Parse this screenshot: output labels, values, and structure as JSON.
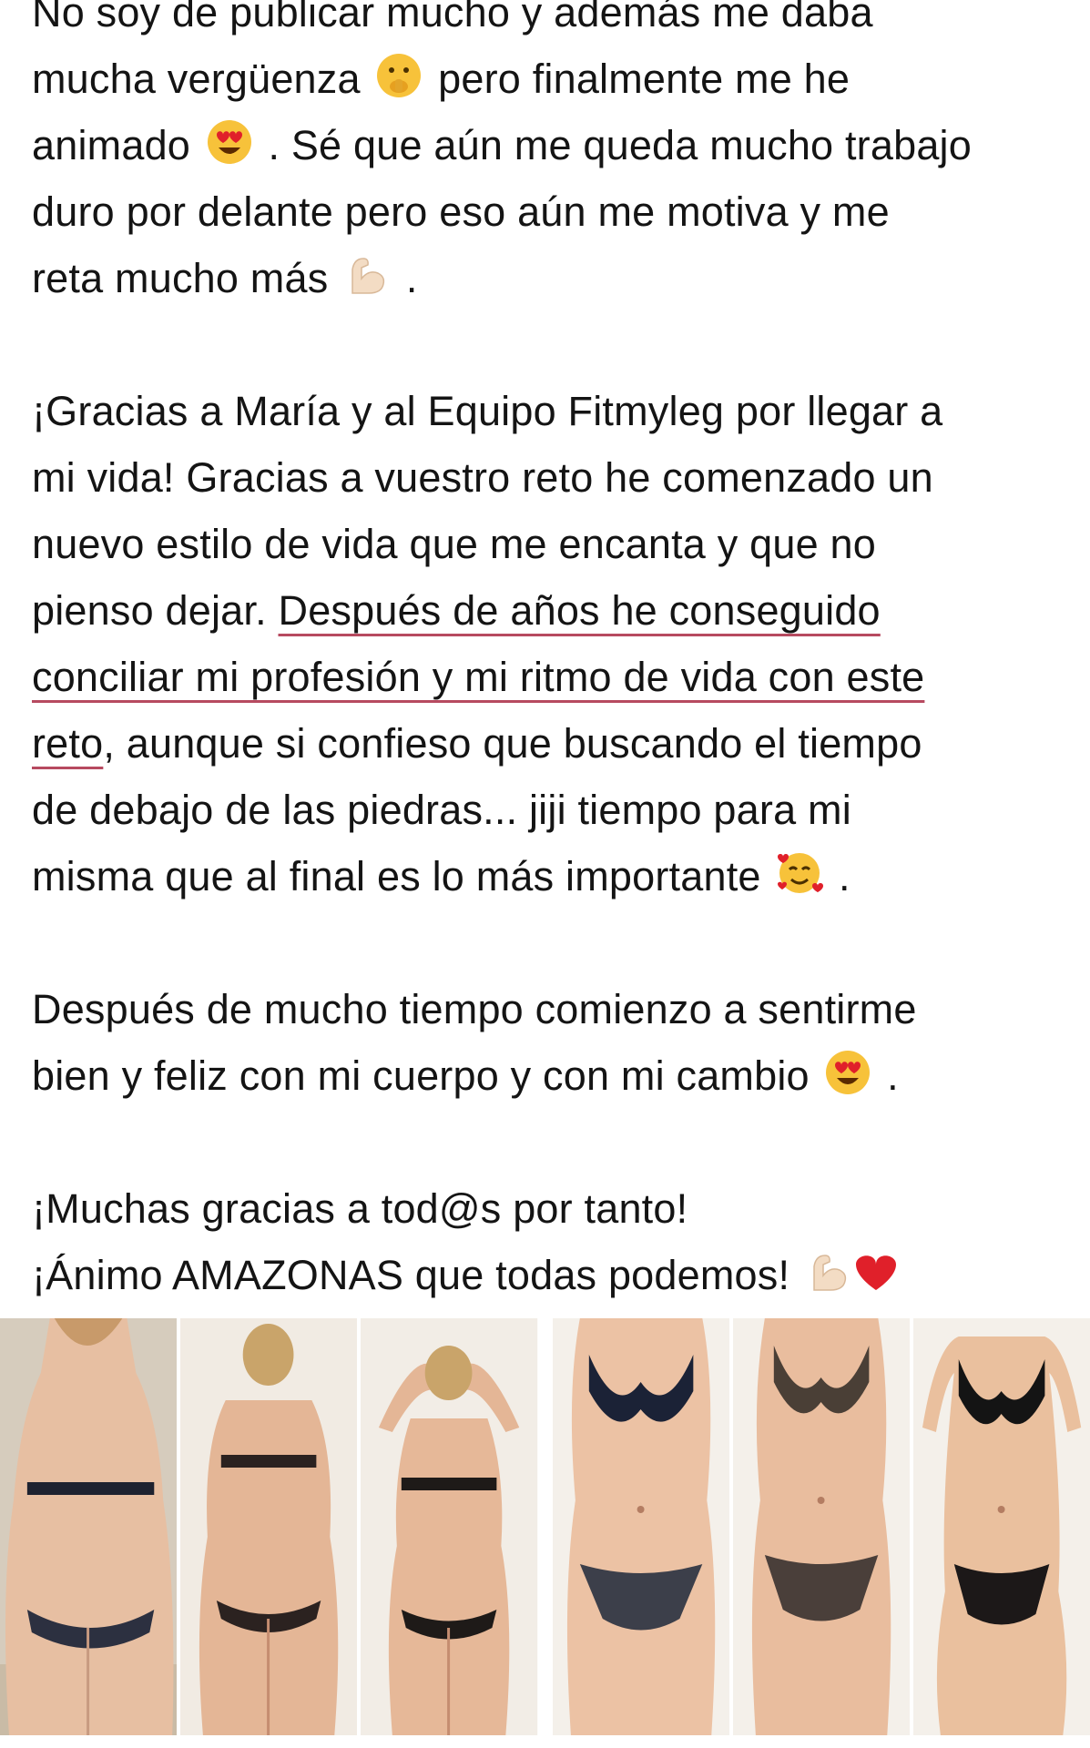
{
  "post": {
    "p1": {
      "l1": "No soy de publicar mucho y además me daba",
      "l2a": "mucha vergüenza",
      "l2b": "pero finalmente me he",
      "l3a": "animado",
      "l3b": ". Sé que aún me queda mucho trabajo",
      "l4": "duro por delante pero eso aún me motiva  y me",
      "l5a": "reta mucho más",
      "l5b": "."
    },
    "p2": {
      "l1": "¡Gracias a María y al Equipo Fitmyleg por llegar a",
      "l2": "mi vida! Gracias a vuestro reto he comenzado un",
      "l3": "nuevo estilo de vida que me encanta y que no",
      "l4a": "pienso dejar. ",
      "l4b": "Después de años he conseguido",
      "l5": "conciliar mi profesión y mi ritmo de vida con este",
      "l6a": "reto",
      "l6b": ", aunque si confieso que buscando el tiempo",
      "l7": "de debajo de las piedras... jiji tiempo para mi",
      "l8a": "misma que al final es lo más importante",
      "l8b": "."
    },
    "p3": {
      "l1": "Después de mucho tiempo comienzo a sentirme",
      "l2a": "bien y feliz con mi cuerpo y con mi cambio",
      "l2b": "."
    },
    "p4": {
      "l1": "¡Muchas gracias a tod@s por tanto!",
      "l2": "¡Ánimo AMAZONAS que todas podemos!"
    }
  },
  "emojis": [
    "shushing-face",
    "heart-eyes",
    "flexed-biceps",
    "smiling-face-with-hearts",
    "heart-eyes",
    "flexed-biceps",
    "red-heart"
  ],
  "photos": [
    "back-before",
    "back-mid",
    "back-after",
    "front-before",
    "front-mid",
    "front-after"
  ],
  "colors": {
    "text": "#141414",
    "underline": "#b74a60",
    "emoji_yellow": "#f7c23a",
    "heart_red": "#e0202a"
  }
}
